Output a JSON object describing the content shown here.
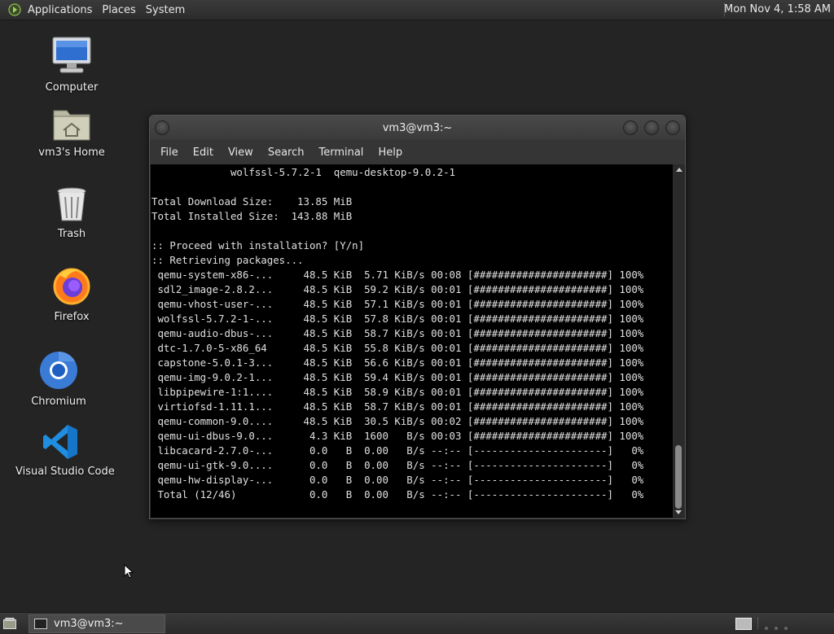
{
  "top_panel": {
    "menus": [
      "Applications",
      "Places",
      "System"
    ],
    "clock": "Mon Nov 4,  1:58 AM"
  },
  "desktop": {
    "icons": [
      {
        "label": "Computer",
        "icon": "computer-icon"
      },
      {
        "label": "vm3's Home",
        "icon": "home-folder-icon"
      },
      {
        "label": "Trash",
        "icon": "trash-icon"
      },
      {
        "label": "Firefox",
        "icon": "firefox-icon"
      },
      {
        "label": "Chromium",
        "icon": "chromium-icon"
      },
      {
        "label": "Visual Studio Code",
        "icon": "vscode-icon"
      }
    ]
  },
  "terminal": {
    "title": "vm3@vm3:~",
    "menus": [
      "File",
      "Edit",
      "View",
      "Search",
      "Terminal",
      "Help"
    ],
    "lines": [
      "             wolfssl-5.7.2-1  qemu-desktop-9.0.2-1",
      "",
      "Total Download Size:    13.85 MiB",
      "Total Installed Size:  143.88 MiB",
      "",
      ":: Proceed with installation? [Y/n]",
      ":: Retrieving packages...",
      " qemu-system-x86-...     48.5 KiB  5.71 KiB/s 00:08 [######################] 100%",
      " sdl2_image-2.8.2...     48.5 KiB  59.2 KiB/s 00:01 [######################] 100%",
      " qemu-vhost-user-...     48.5 KiB  57.1 KiB/s 00:01 [######################] 100%",
      " wolfssl-5.7.2-1-...     48.5 KiB  57.8 KiB/s 00:01 [######################] 100%",
      " qemu-audio-dbus-...     48.5 KiB  58.7 KiB/s 00:01 [######################] 100%",
      " dtc-1.7.0-5-x86_64      48.5 KiB  55.8 KiB/s 00:01 [######################] 100%",
      " capstone-5.0.1-3...     48.5 KiB  56.6 KiB/s 00:01 [######################] 100%",
      " qemu-img-9.0.2-1...     48.5 KiB  59.4 KiB/s 00:01 [######################] 100%",
      " libpipewire-1:1....     48.5 KiB  58.9 KiB/s 00:01 [######################] 100%",
      " virtiofsd-1.11.1...     48.5 KiB  58.7 KiB/s 00:01 [######################] 100%",
      " qemu-common-9.0....     48.5 KiB  30.5 KiB/s 00:02 [######################] 100%",
      " qemu-ui-dbus-9.0...      4.3 KiB  1600   B/s 00:03 [######################] 100%",
      " libcacard-2.7.0-...      0.0   B  0.00   B/s --:-- [----------------------]   0%",
      " qemu-ui-gtk-9.0....      0.0   B  0.00   B/s --:-- [----------------------]   0%",
      " qemu-hw-display-...      0.0   B  0.00   B/s --:-- [----------------------]   0%",
      " Total (12/46)            0.0   B  0.00   B/s --:-- [----------------------]   0%"
    ],
    "scroll_position": 0.82
  },
  "bottom_panel": {
    "task_label": "vm3@vm3:~"
  }
}
